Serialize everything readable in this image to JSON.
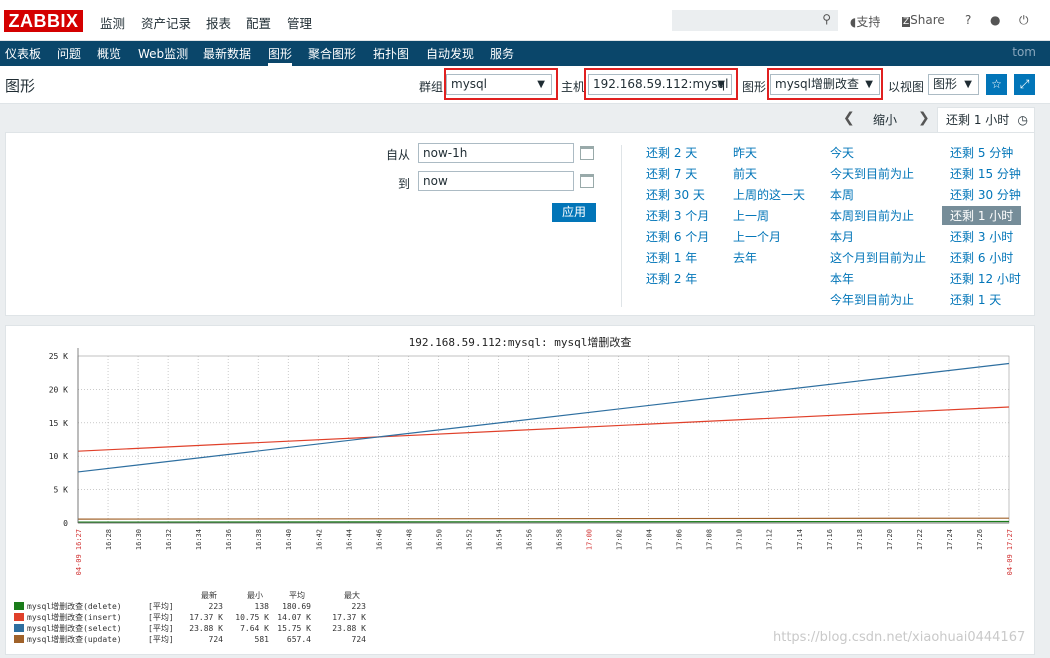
{
  "top": {
    "logo": "ZABBIX",
    "menu": [
      "监测",
      "资产记录",
      "报表",
      "配置",
      "管理"
    ],
    "support": "支持",
    "share": "Share",
    "help": "?"
  },
  "subnav": {
    "items": [
      "仪表板",
      "问题",
      "概览",
      "Web监测",
      "最新数据",
      "图形",
      "聚合图形",
      "拓扑图",
      "自动发现",
      "服务"
    ],
    "user": "tom"
  },
  "header": {
    "title": "图形",
    "group_label": "群组",
    "group_value": "mysql",
    "host_label": "主机",
    "host_value": "192.168.59.112:mysql",
    "graph_label": "图形",
    "graph_value": "mysql增删改查",
    "view_label": "以视图",
    "view_value": "图形"
  },
  "time": {
    "zoom_out": "缩小",
    "active_tab": "还剩 1 小时",
    "from_label": "自从",
    "from_value": "now-1h",
    "to_label": "到",
    "to_value": "now",
    "apply": "应用",
    "quick": {
      "col1": [
        "还剩 2 天",
        "还剩 7 天",
        "还剩 30 天",
        "还剩 3 个月",
        "还剩 6 个月",
        "还剩 1 年",
        "还剩 2 年"
      ],
      "col2": [
        "昨天",
        "前天",
        "上周的这一天",
        "上一周",
        "上一个月",
        "去年"
      ],
      "col3": [
        "今天",
        "今天到目前为止",
        "本周",
        "本周到目前为止",
        "本月",
        "这个月到目前为止",
        "本年",
        "今年到目前为止"
      ],
      "col4": [
        "还剩 5 分钟",
        "还剩 15 分钟",
        "还剩 30 分钟",
        "还剩 1 小时",
        "还剩 3 小时",
        "还剩 6 小时",
        "还剩 12 小时",
        "还剩 1 天"
      ]
    }
  },
  "chart_data": {
    "type": "line",
    "title": "192.168.59.112:mysql: mysql增删改查",
    "ylim": [
      0,
      25000
    ],
    "yticks": [
      "0",
      "5 K",
      "10 K",
      "15 K",
      "20 K",
      "25 K"
    ],
    "x_start_label": "04-09 16:27",
    "x_end_label": "04-09 17:27",
    "x_ticks": [
      "16:28",
      "16:30",
      "16:32",
      "16:34",
      "16:36",
      "16:38",
      "16:40",
      "16:42",
      "16:44",
      "16:46",
      "16:48",
      "16:50",
      "16:52",
      "16:54",
      "16:56",
      "16:58",
      "17:00",
      "17:02",
      "17:04",
      "17:06",
      "17:08",
      "17:10",
      "17:12",
      "17:14",
      "17:16",
      "17:18",
      "17:20",
      "17:22",
      "17:24",
      "17:26"
    ],
    "legend_headers": [
      "最新",
      "最小",
      "平均",
      "最大"
    ],
    "series": [
      {
        "name": "mysql增删改查(delete)",
        "func": "[平均]",
        "color": "#1a7c1a",
        "start": 138,
        "end": 223,
        "last": "223",
        "min": "138",
        "avg": "180.69",
        "max": "223"
      },
      {
        "name": "mysql增删改查(insert)",
        "func": "[平均]",
        "color": "#e0402a",
        "start": 10750,
        "end": 17370,
        "last": "17.37 K",
        "min": "10.75 K",
        "avg": "14.07 K",
        "max": "17.37 K"
      },
      {
        "name": "mysql增删改查(select)",
        "func": "[平均]",
        "color": "#2e6fa0",
        "start": 7640,
        "end": 23880,
        "last": "23.88 K",
        "min": "7.64 K",
        "avg": "15.75 K",
        "max": "23.88 K"
      },
      {
        "name": "mysql增删改查(update)",
        "func": "[平均]",
        "color": "#a0622a",
        "start": 581,
        "end": 724,
        "last": "724",
        "min": "581",
        "avg": "657.4",
        "max": "724"
      }
    ]
  },
  "watermark": "https://blog.csdn.net/xiaohuai0444167"
}
